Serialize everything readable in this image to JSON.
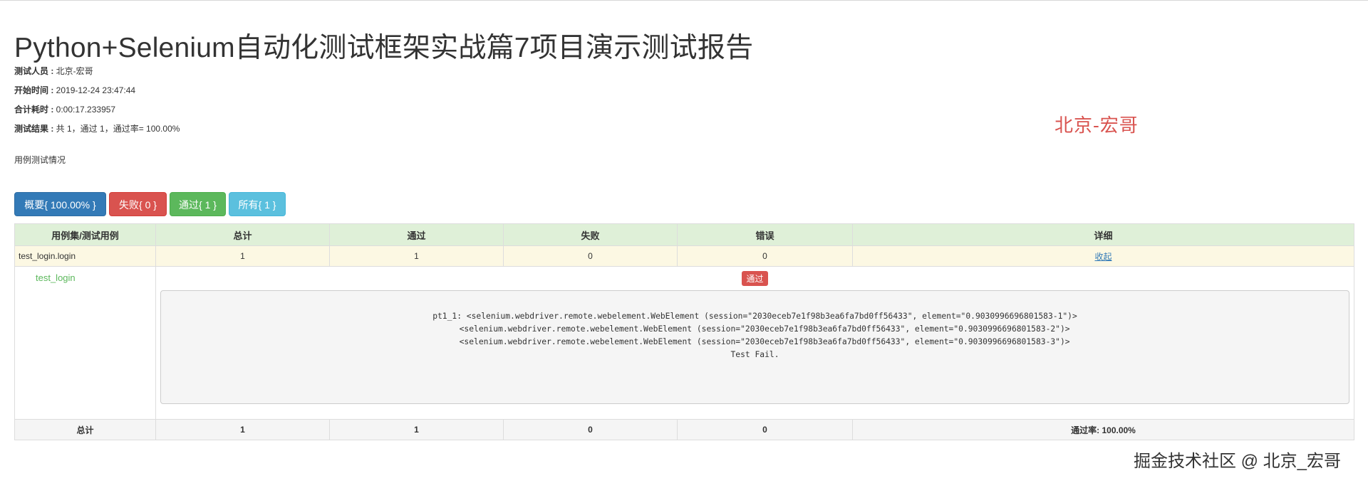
{
  "report": {
    "title": "Python+Selenium自动化测试框架实战篇7项目演示测试报告",
    "tester_label": "测试人员 :",
    "tester_value": " 北京-宏哥",
    "start_label": "开始时间 :",
    "start_value": " 2019-12-24 23:47:44",
    "duration_label": "合计耗时 :",
    "duration_value": " 0:00:17.233957",
    "result_label": "测试结果 :",
    "result_value": " 共 1，通过 1，通过率= 100.00%",
    "subheading": "用例测试情况"
  },
  "watermark": "北京-宏哥",
  "filters": {
    "summary": "概要{ 100.00% }",
    "failed": "失败{ 0 }",
    "passed": "通过{ 1 }",
    "all": "所有{ 1 }"
  },
  "table": {
    "headers": [
      "用例集/测试用例",
      "总计",
      "通过",
      "失败",
      "错误",
      "详细"
    ],
    "suite": {
      "name": "test_login.login",
      "total": "1",
      "pass": "1",
      "fail": "0",
      "error": "0",
      "detail_link": "收起"
    },
    "case": {
      "name": "test_login",
      "status": "通过",
      "log": "pt1_1: <selenium.webdriver.remote.webelement.WebElement (session=\"2030eceb7e1f98b3ea6fa7bd0ff56433\", element=\"0.9030996696801583-1\")>\n    <selenium.webdriver.remote.webelement.WebElement (session=\"2030eceb7e1f98b3ea6fa7bd0ff56433\", element=\"0.9030996696801583-2\")>\n    <selenium.webdriver.remote.webelement.WebElement (session=\"2030eceb7e1f98b3ea6fa7bd0ff56433\", element=\"0.9030996696801583-3\")>\nTest Fail."
    },
    "total_row": {
      "label": "总计",
      "total": "1",
      "pass": "1",
      "fail": "0",
      "error": "0",
      "rate": "通过率: 100.00%"
    }
  },
  "footer": "掘金技术社区 @ 北京_宏哥",
  "colors": {
    "primary": "#337ab7",
    "danger": "#d9534f",
    "success": "#5cb85c",
    "info": "#5bc0de",
    "header_bg": "#dff0d8",
    "suite_bg": "#fcf8e3"
  }
}
